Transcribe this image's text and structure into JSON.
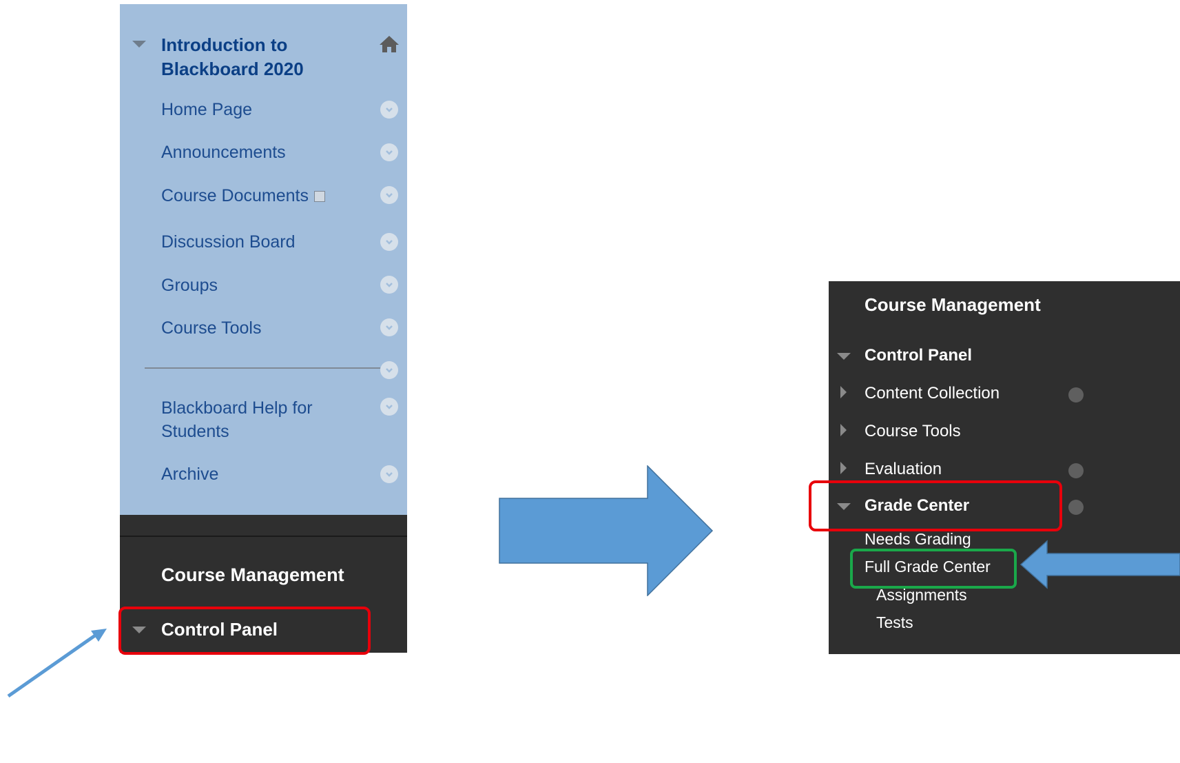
{
  "left_menu": {
    "course_title": "Introduction to Blackboard 2020",
    "items": [
      {
        "label": "Home Page"
      },
      {
        "label": "Announcements"
      },
      {
        "label": "Course Documents"
      },
      {
        "label": "Discussion Board"
      },
      {
        "label": "Groups"
      },
      {
        "label": "Course Tools"
      },
      {
        "label": "Blackboard Help for Students"
      },
      {
        "label": "Archive"
      }
    ],
    "management_title": "Course Management",
    "control_panel_label": "Control Panel"
  },
  "right_menu": {
    "management_title": "Course Management",
    "control_panel_label": "Control Panel",
    "items": [
      {
        "label": "Content Collection"
      },
      {
        "label": "Course Tools"
      },
      {
        "label": "Evaluation"
      },
      {
        "label": "Grade Center"
      }
    ],
    "grade_center_subitems": [
      {
        "label": "Needs Grading"
      },
      {
        "label": "Full Grade Center"
      },
      {
        "label": "Assignments"
      },
      {
        "label": "Tests"
      }
    ]
  },
  "colors": {
    "menu_light_bg": "#a2bedc",
    "menu_dark_bg": "#2f2f2f",
    "highlight_red": "#e8000b",
    "highlight_green": "#1aa84a",
    "arrow_blue": "#5b9bd5"
  }
}
